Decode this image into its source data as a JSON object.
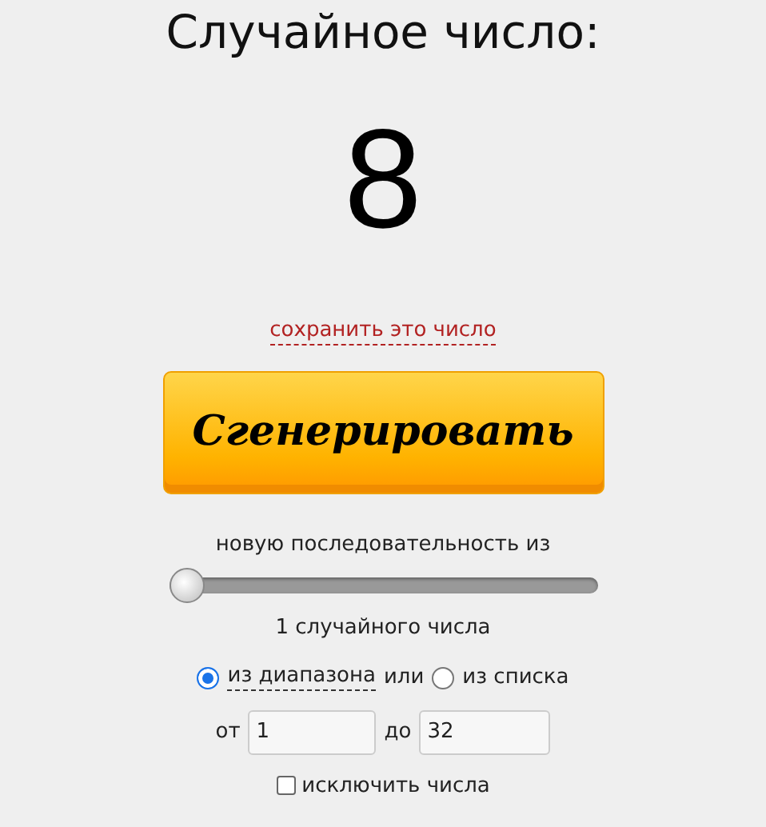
{
  "title": "Случайное число:",
  "result": "8",
  "save_link": "сохранить это число",
  "generate_button": "Сгенерировать",
  "sequence_label": "новую последовательность из",
  "count_slider": {
    "level": 0
  },
  "count_text": "1 случайного числа",
  "source_options": [
    {
      "label": "из диапазона",
      "selected": true
    },
    {
      "label": "из списка",
      "selected": false
    }
  ],
  "or_text": "или",
  "range": {
    "from_label": "от",
    "from_value": "1",
    "to_label": "до",
    "to_value": "32"
  },
  "exclude": {
    "label": "исключить числа",
    "checked": false
  }
}
